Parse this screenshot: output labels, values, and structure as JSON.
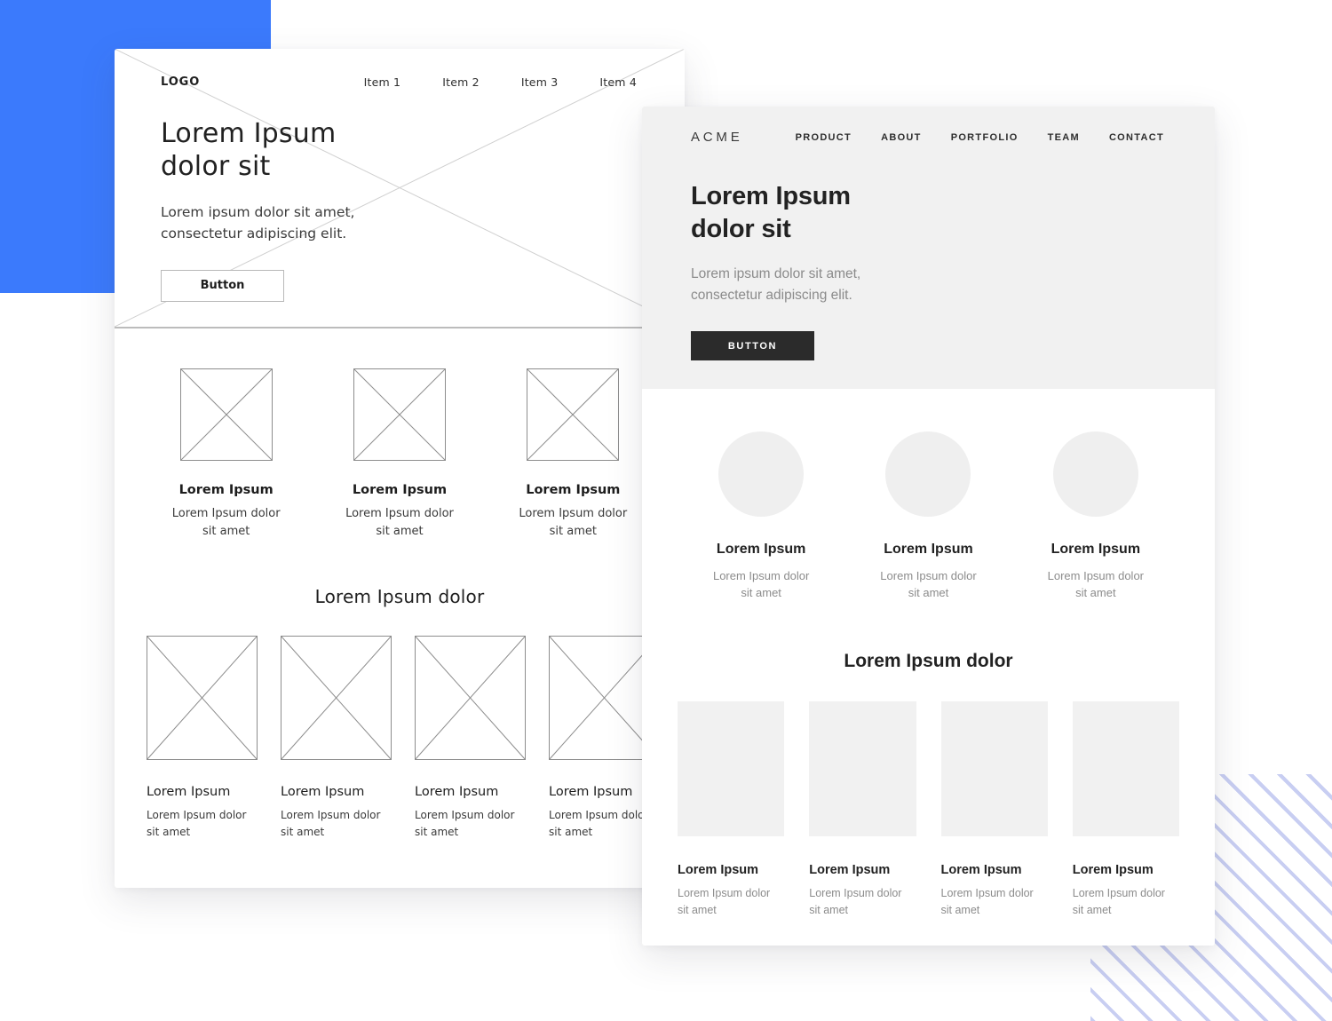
{
  "decor": {
    "blue_square_color": "#3b7afc",
    "stripes_color": "#c8cef2"
  },
  "sketch_card": {
    "logo": "LOGO",
    "nav": [
      {
        "label": "Item 1"
      },
      {
        "label": "Item 2"
      },
      {
        "label": "Item 3"
      },
      {
        "label": "Item 4"
      }
    ],
    "hero": {
      "heading_line1": "Lorem Ipsum",
      "heading_line2": "dolor sit",
      "subtext_line1": "Lorem ipsum dolor sit amet,",
      "subtext_line2": "consectetur adipiscing elit.",
      "button_label": "Button"
    },
    "features": [
      {
        "title": "Lorem Ipsum",
        "desc_line1": "Lorem Ipsum dolor",
        "desc_line2": "sit amet"
      },
      {
        "title": "Lorem Ipsum",
        "desc_line1": "Lorem Ipsum dolor",
        "desc_line2": "sit amet"
      },
      {
        "title": "Lorem Ipsum",
        "desc_line1": "Lorem Ipsum dolor",
        "desc_line2": "sit amet"
      }
    ],
    "section_title": "Lorem Ipsum dolor",
    "gallery": [
      {
        "title": "Lorem Ipsum",
        "desc_line1": "Lorem Ipsum dolor",
        "desc_line2": "sit amet"
      },
      {
        "title": "Lorem Ipsum",
        "desc_line1": "Lorem Ipsum dolor",
        "desc_line2": "sit amet"
      },
      {
        "title": "Lorem Ipsum",
        "desc_line1": "Lorem Ipsum dolor",
        "desc_line2": "sit amet"
      },
      {
        "title": "Lorem Ipsum",
        "desc_line1": "Lorem Ipsum dolor",
        "desc_line2": "sit amet"
      }
    ]
  },
  "clean_card": {
    "logo": "ACME",
    "nav": [
      {
        "label": "PRODUCT"
      },
      {
        "label": "ABOUT"
      },
      {
        "label": "PORTFOLIO"
      },
      {
        "label": "TEAM"
      },
      {
        "label": "CONTACT"
      }
    ],
    "hero": {
      "heading_line1": "Lorem Ipsum",
      "heading_line2": "dolor sit",
      "subtext_line1": "Lorem ipsum dolor sit amet,",
      "subtext_line2": "consectetur adipiscing elit.",
      "button_label": "BUTTON",
      "background_color": "#f1f1f1",
      "button_color": "#2b2b2b"
    },
    "features": [
      {
        "title": "Lorem Ipsum",
        "desc_line1": "Lorem Ipsum dolor",
        "desc_line2": "sit amet"
      },
      {
        "title": "Lorem Ipsum",
        "desc_line1": "Lorem Ipsum dolor",
        "desc_line2": "sit amet"
      },
      {
        "title": "Lorem Ipsum",
        "desc_line1": "Lorem Ipsum dolor",
        "desc_line2": "sit amet"
      }
    ],
    "section_title": "Lorem Ipsum dolor",
    "gallery": [
      {
        "title": "Lorem Ipsum",
        "desc_line1": "Lorem Ipsum dolor",
        "desc_line2": "sit amet"
      },
      {
        "title": "Lorem Ipsum",
        "desc_line1": "Lorem Ipsum dolor",
        "desc_line2": "sit amet"
      },
      {
        "title": "Lorem Ipsum",
        "desc_line1": "Lorem Ipsum dolor",
        "desc_line2": "sit amet"
      },
      {
        "title": "Lorem Ipsum",
        "desc_line1": "Lorem Ipsum dolor",
        "desc_line2": "sit amet"
      }
    ]
  }
}
